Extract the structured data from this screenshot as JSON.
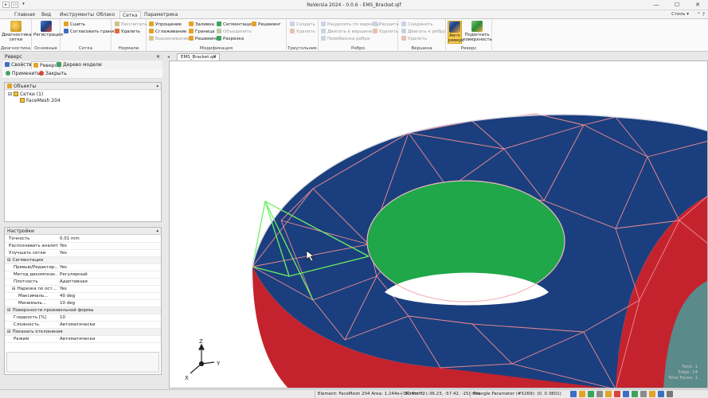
{
  "window": {
    "title": "ReVersia 2024 - 0.0.6 - EMS_Bracket.qif",
    "controls": [
      "—",
      "☐",
      "✕"
    ]
  },
  "ribbon_tabs": [
    {
      "label": "Главная",
      "active": false
    },
    {
      "label": "Вид",
      "active": false
    },
    {
      "label": "Инструменты",
      "active": false
    },
    {
      "label": "Облако",
      "active": false
    },
    {
      "label": "Сетка",
      "active": true
    },
    {
      "label": "Параметрика",
      "active": false
    }
  ],
  "style_menu": "Стиль",
  "ribbon": {
    "diagnostics": {
      "label": "Диагностика",
      "button": "Диагностика сетки"
    },
    "basic": {
      "label": "Основные",
      "button": "Регистрация"
    },
    "mesh": {
      "label": "Сетка",
      "buttons": [
        "Сшить",
        "Согласовать грани"
      ]
    },
    "normals": {
      "label": "Нормали",
      "buttons": [
        "Рассчитать",
        "Удалить"
      ]
    },
    "modify": {
      "label": "Модификация",
      "buttons": [
        "Упрощение",
        "Сглаживание",
        "Выравнивание",
        "Заливка",
        "Граница",
        "Решеиинг",
        "Сегментация",
        "Объединить",
        "Разрезка",
        "Решеиинг"
      ]
    },
    "triangle": {
      "label": "Треугольник",
      "buttons": [
        "Создать",
        "Удалить"
      ]
    },
    "edge": {
      "label": "Ребро",
      "buttons": [
        "Разделить по маркеру",
        "Двигать к вершине",
        "Переброска ребра",
        "Расшить",
        "Удалить"
      ]
    },
    "vertex": {
      "label": "Вершина",
      "buttons": [
        "Соединить",
        "Двигать к ребру",
        "Удалить"
      ]
    },
    "reverse": {
      "label": "Реверс",
      "buttons": [
        "Авто реверс",
        "Подогнать поверхность"
      ]
    }
  },
  "left_panel": {
    "title": "Реверс",
    "tabs": [
      "Свойства",
      "Реверс",
      "Дерево модели"
    ],
    "actions": {
      "apply": "Применить",
      "close": "Закрыть"
    },
    "objects": {
      "header": "Объекты",
      "tree": [
        {
          "label": "Сетки (1)",
          "level": 0,
          "expander": "⊟"
        },
        {
          "label": "FaceMesh 204",
          "level": 1,
          "expander": ""
        }
      ]
    },
    "settings": {
      "header": "Настройки",
      "rows": [
        {
          "key": "Точность",
          "value": "0.01 mm",
          "indent": 0,
          "category": false,
          "expander": ""
        },
        {
          "key": "Распознавать аналити...",
          "value": "Yes",
          "indent": 0,
          "category": false,
          "expander": ""
        },
        {
          "key": "Улучшать сетки",
          "value": "Yes",
          "indent": 0,
          "category": false,
          "expander": ""
        },
        {
          "key": "Сегментация",
          "value": "",
          "indent": 0,
          "category": true,
          "expander": "⊟"
        },
        {
          "key": "Превью/Редактир...",
          "value": "Yes",
          "indent": 1,
          "category": false,
          "expander": ""
        },
        {
          "key": "Метод декомпози...",
          "value": "Регулярный",
          "indent": 1,
          "category": false,
          "expander": ""
        },
        {
          "key": "Плотность",
          "value": "Адаптивная",
          "indent": 1,
          "category": false,
          "expander": ""
        },
        {
          "key": "Нарезка по ост...",
          "value": "Yes",
          "indent": 1,
          "category": false,
          "expander": "⊟"
        },
        {
          "key": "Максималь...",
          "value": "40 deg",
          "indent": 2,
          "category": false,
          "expander": ""
        },
        {
          "key": "Минималь...",
          "value": "10 deg",
          "indent": 2,
          "category": false,
          "expander": ""
        },
        {
          "key": "Поверхности произвольной формы",
          "value": "",
          "indent": 0,
          "category": true,
          "expander": "⊟"
        },
        {
          "key": "Гладкость [%]",
          "value": "10",
          "indent": 1,
          "category": false,
          "expander": ""
        },
        {
          "key": "Сложность",
          "value": "Автоматически",
          "indent": 1,
          "category": false,
          "expander": ""
        },
        {
          "key": "Показать отклонения",
          "value": "",
          "indent": 0,
          "category": true,
          "expander": "⊟"
        },
        {
          "key": "Режим",
          "value": "Автоматически",
          "indent": 1,
          "category": false,
          "expander": ""
        }
      ]
    }
  },
  "document_tab": {
    "label": "EMS_Bracket.qif",
    "close": "×"
  },
  "viewport": {
    "axes": {
      "x": "X",
      "y": "Y",
      "z": "Z"
    },
    "overlay_lines": [
      "Face: 1",
      "Edge: 14",
      "Total Faces: 1"
    ]
  },
  "status_bar": {
    "element": "Element: FaceMesh 204 Area: 1.244e+04 mm^2",
    "point": "3D Point: (-36.23, -57.42, -15) mm",
    "param": "Triangle Parameter (#5269): (0, 0.3801)"
  },
  "colors": {
    "mesh_face": "#1b3f7e",
    "wall": "#c4232e",
    "hole": "#1fa74a",
    "edges": "#f08a92",
    "selected_edges": "#6cf062",
    "accent": "#f7c94b"
  }
}
